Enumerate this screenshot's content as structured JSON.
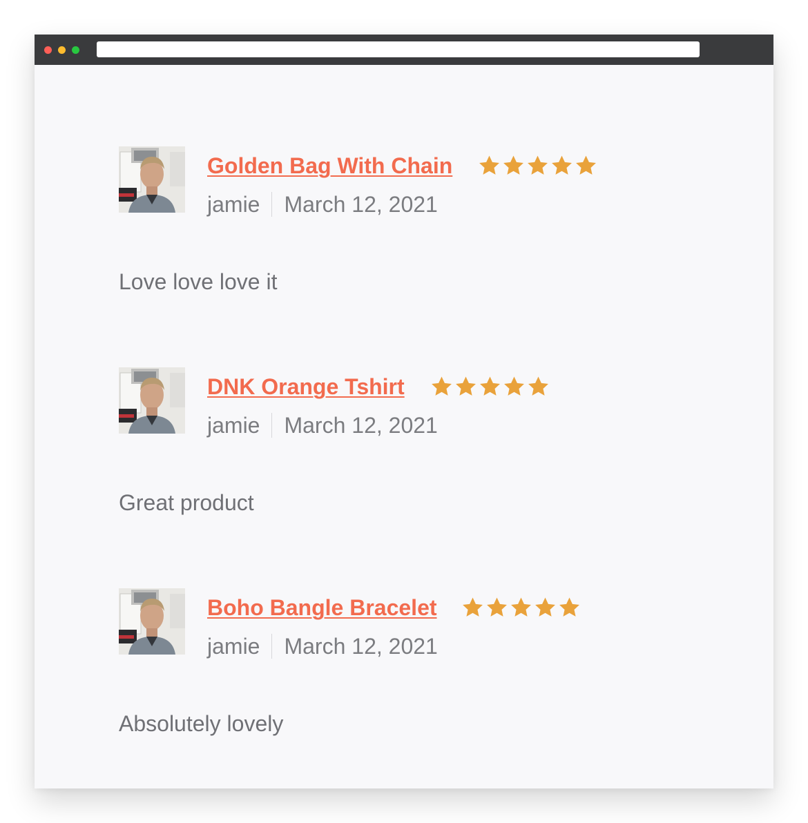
{
  "colors": {
    "accent": "#f26b4e",
    "star": "#e9a23b",
    "text": "#6f7075"
  },
  "reviews": [
    {
      "product": "Golden Bag With Chain",
      "rating": 5,
      "author": "jamie",
      "date": "March 12, 2021",
      "text": "Love love love it",
      "avatar_icon": "reviewer-avatar"
    },
    {
      "product": "DNK Orange Tshirt",
      "rating": 5,
      "author": "jamie",
      "date": "March 12, 2021",
      "text": "Great product",
      "avatar_icon": "reviewer-avatar"
    },
    {
      "product": "Boho Bangle Bracelet",
      "rating": 5,
      "author": "jamie",
      "date": "March 12, 2021",
      "text": "Absolutely lovely",
      "avatar_icon": "reviewer-avatar"
    }
  ]
}
